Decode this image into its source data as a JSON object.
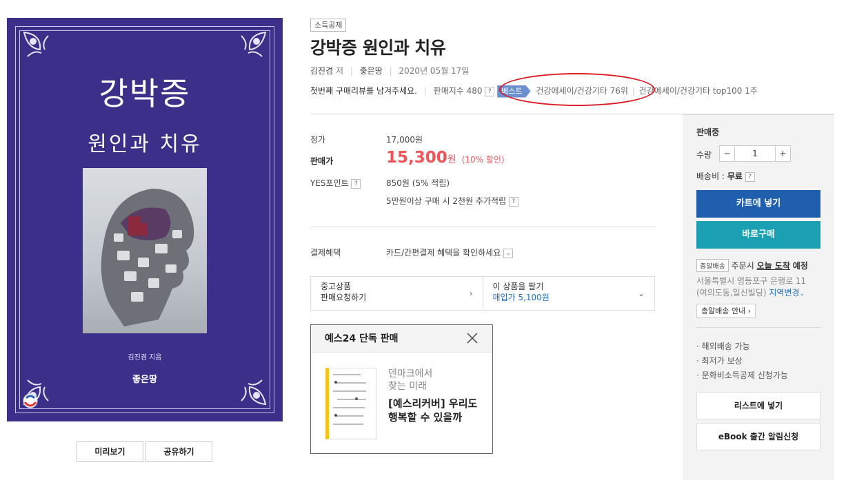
{
  "cover": {
    "title": "강박증",
    "subtitle": "원인과 치유",
    "author": "김진겸 지음",
    "publisher": "좋은땅"
  },
  "cover_buttons": {
    "preview": "미리보기",
    "share": "공유하기"
  },
  "product": {
    "badge": "소득공제",
    "title": "강박증 원인과 치유",
    "author": "김진겸",
    "author_suffix": "저",
    "publisher": "좋은땅",
    "date": "2020년 05월 17일",
    "review_prompt": "첫번째 구매리뷰를 남겨주세요.",
    "sales_index": "판매지수 480",
    "best_tag": "베스트",
    "rank1": "건강에세이/건강기타 76위",
    "rank2": "건강에세이/건강기타 top100 1주"
  },
  "price": {
    "list_label": "정가",
    "list_value": "17,000원",
    "sale_label": "판매가",
    "sale_value": "15,300",
    "sale_unit": "원",
    "discount": "(10% 할인)",
    "points_label": "YES포인트",
    "points_value": "850원 (5% 적립)",
    "bonus": "5만원이상 구매 시 2천원 추가적립",
    "payment_label": "결제혜택",
    "payment_value": "카드/간편결제 혜택을 확인하세요"
  },
  "used": {
    "left_line1": "중고상품",
    "left_line2": "판매요청하기",
    "right_line1": "이 상품을 팔기",
    "right_line2": "매입가 5,100원"
  },
  "exclusive": {
    "header": "예스24 단독 판매",
    "line1a": "덴마크에서",
    "line1b": "찾는 미래",
    "line2": "[예스리커버] 우리도 행복할 수 있을까"
  },
  "panel": {
    "status": "판매중",
    "qty_label": "수량",
    "qty_minus": "−",
    "qty_value": "1",
    "qty_plus": "+",
    "shipping_label": "배송비 :",
    "shipping_value": "무료",
    "cart": "카트에 넣기",
    "buy": "바로구매",
    "delivery_tag": "총알배송",
    "delivery_prefix": "주문시",
    "delivery_strong": "오늘 도착",
    "delivery_suffix": "예정",
    "address1": "서울특별시 영등포구 은행로 11",
    "address2": "(여의도동,일신빌딩)",
    "change_region": "지역변경",
    "delivery_info": "총알배송 안내",
    "features": [
      "해외배송 가능",
      "최저가 보상",
      "문화비소득공제 신청가능"
    ],
    "wishlist": "리스트에 넣기",
    "ebook": "eBook 출간 알림신청"
  },
  "colors": {
    "cover_bg": "#3b2f8a",
    "price_red": "#f0555a",
    "cart_blue": "#1f5fad",
    "buy_teal": "#1ba0b3",
    "best_blue": "#6b8fcf",
    "highlight_red": "#e0161e"
  }
}
